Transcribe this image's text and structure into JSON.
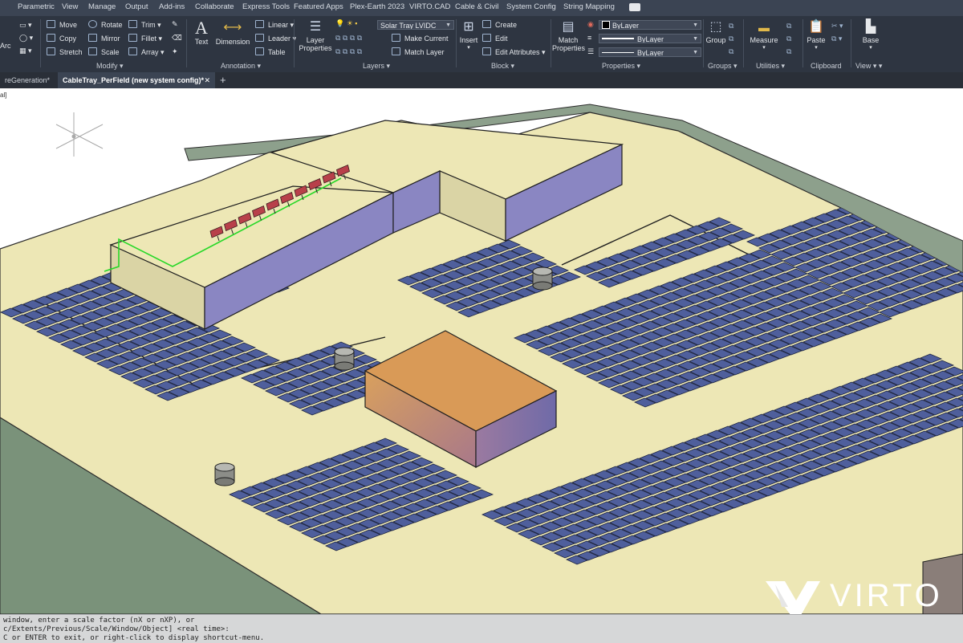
{
  "menu": [
    "Parametric",
    "View",
    "Manage",
    "Output",
    "Add-ins",
    "Collaborate",
    "Express Tools",
    "Featured Apps",
    "Plex-Earth 2023",
    "VIRTO.CAD",
    "Cable & Civil",
    "System Config",
    "String Mapping"
  ],
  "ribbon": {
    "draw": {
      "arc": "Arc"
    },
    "modify": {
      "title": "Modify",
      "move": "Move",
      "rotate": "Rotate",
      "trim": "Trim",
      "copy": "Copy",
      "mirror": "Mirror",
      "fillet": "Fillet",
      "stretch": "Stretch",
      "scale": "Scale",
      "array": "Array"
    },
    "annotation": {
      "title": "Annotation",
      "text": "Text",
      "dimension": "Dimension",
      "linear": "Linear",
      "leader": "Leader",
      "table": "Table"
    },
    "layers": {
      "title": "Layers",
      "layer_properties": "Layer Properties",
      "current_layer": "Solar Tray LVIDC",
      "make_current": "Make Current",
      "match_layer": "Match Layer"
    },
    "block": {
      "title": "Block",
      "insert": "Insert",
      "create": "Create",
      "edit": "Edit",
      "edit_attributes": "Edit Attributes"
    },
    "properties": {
      "title": "Properties",
      "match_properties": "Match Properties",
      "color": "ByLayer",
      "linetype": "ByLayer",
      "lineweight": "ByLayer"
    },
    "groups": {
      "title": "Groups",
      "group": "Group"
    },
    "utilities": {
      "title": "Utilities",
      "measure": "Measure"
    },
    "clipboard": {
      "title": "Clipboard",
      "paste": "Paste"
    },
    "view": {
      "title": "View",
      "base": "Base"
    }
  },
  "tabs": [
    {
      "label": "reGeneration*"
    },
    {
      "label": "CableTray_PerField (new system config)*"
    }
  ],
  "viewport": {
    "view_label": "al]"
  },
  "command_line": [
    "window, enter a scale factor (nX or nXP), or",
    "c/Extents/Previous/Scale/Window/Object] <real time>:",
    "C or ENTER to exit, or right-click to display shortcut-menu."
  ],
  "brand": {
    "name": "VIRTO"
  },
  "colors": {
    "panel_fill": "#4f5f9c",
    "ground": "#ede7b5",
    "building_orange": "#d99a57",
    "building_purple": "#8a86c2",
    "wall_green": "#7a927a"
  }
}
